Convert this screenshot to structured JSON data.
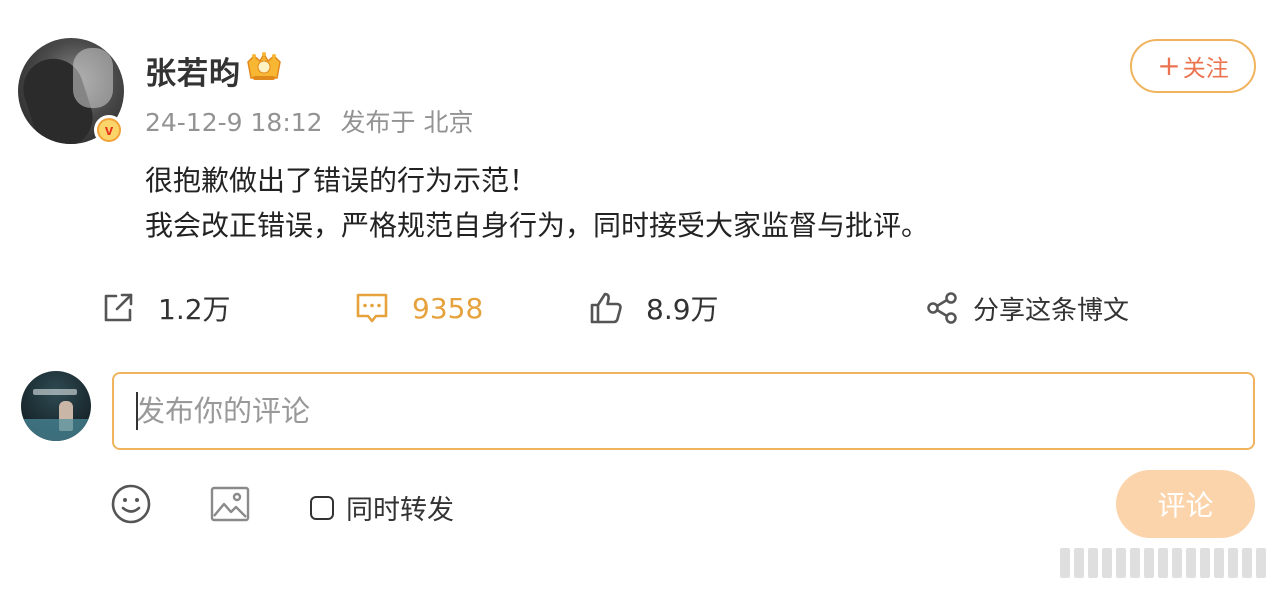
{
  "post": {
    "author": "张若昀",
    "vip_icon": "vip-crown-icon",
    "verified_icon": "verified-v-icon",
    "verified_mark": "v",
    "time": "24-12-9 18:12",
    "source": "发布于 北京",
    "follow_plus": "+",
    "follow_label": "关注",
    "text_line1": "很抱歉做出了错误的行为示范！",
    "text_line2": "我会改正错误，严格规范自身行为，同时接受大家监督与批评。"
  },
  "actions": {
    "forward_count": "1.2万",
    "comment_count": "9358",
    "like_count": "8.9万",
    "share_label": "分享这条博文"
  },
  "composer": {
    "placeholder": "发布你的评论",
    "repost_label": "同时转发",
    "submit_label": "评论",
    "repost_checked": false
  },
  "colors": {
    "accent": "#eb7350",
    "follow_border": "#f0b35e",
    "comment_count": "#e6a23c",
    "submit_disabled": "#fcd4ab",
    "meta_text": "#939393"
  }
}
